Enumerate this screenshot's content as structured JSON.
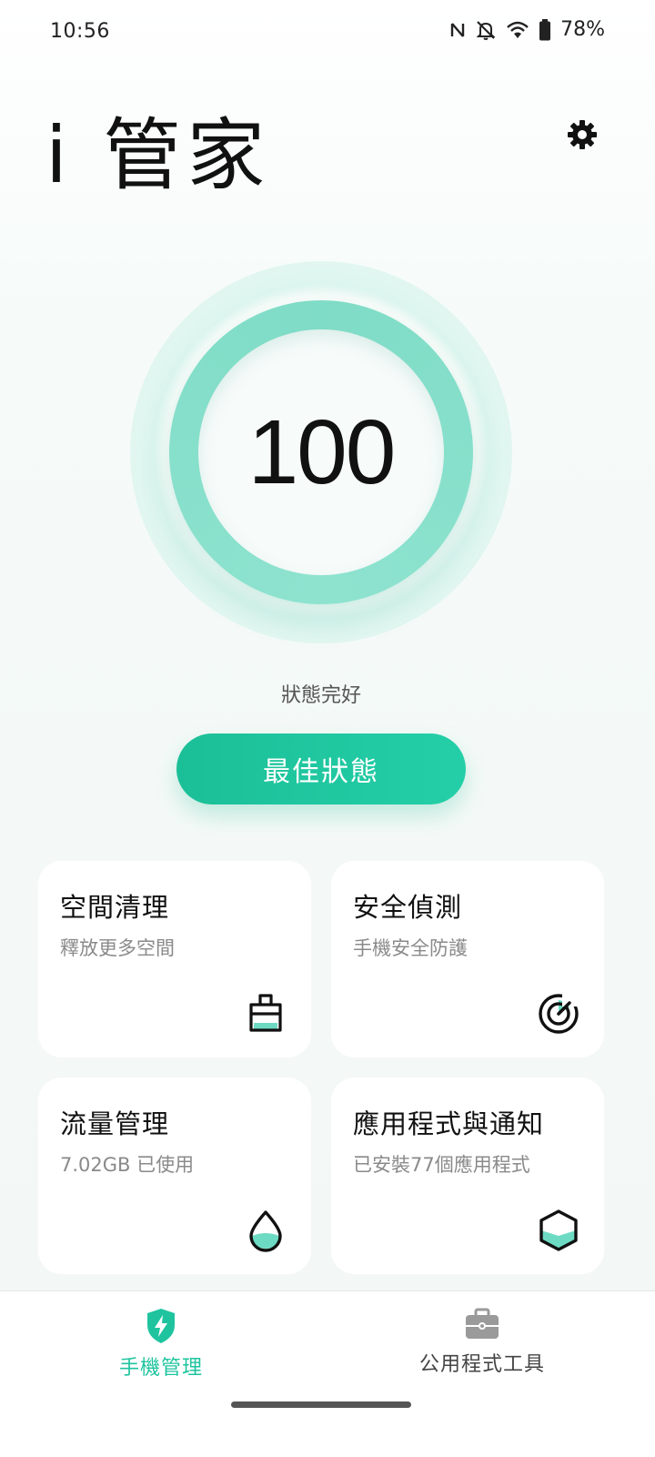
{
  "status_bar": {
    "time": "10:56",
    "battery": "78%",
    "icons": [
      "nfc-icon",
      "bell-off-icon",
      "wifi-icon",
      "battery-icon"
    ]
  },
  "header": {
    "title": "i 管家",
    "settings_icon": "gear-icon"
  },
  "score": {
    "value": "100",
    "status": "狀態完好",
    "button_label": "最佳狀態",
    "ring_color": "#7fdcc6"
  },
  "cards": [
    {
      "title": "空間清理",
      "subtitle": "釋放更多空間",
      "icon": "broom-icon"
    },
    {
      "title": "安全偵測",
      "subtitle": "手機安全防護",
      "icon": "radar-icon"
    },
    {
      "title": "流量管理",
      "subtitle": "7.02GB 已使用",
      "icon": "water-drop-icon"
    },
    {
      "title": "應用程式與通知",
      "subtitle": "已安裝77個應用程式",
      "icon": "hexagon-icon"
    }
  ],
  "bottom_nav": [
    {
      "label": "手機管理",
      "icon": "shield-bolt-icon",
      "active": true
    },
    {
      "label": "公用程式工具",
      "icon": "toolbox-icon",
      "active": false
    }
  ],
  "colors": {
    "accent": "#1fc49f",
    "icon_fill": "#6ddbc3",
    "inactive": "#9a9a9a"
  }
}
